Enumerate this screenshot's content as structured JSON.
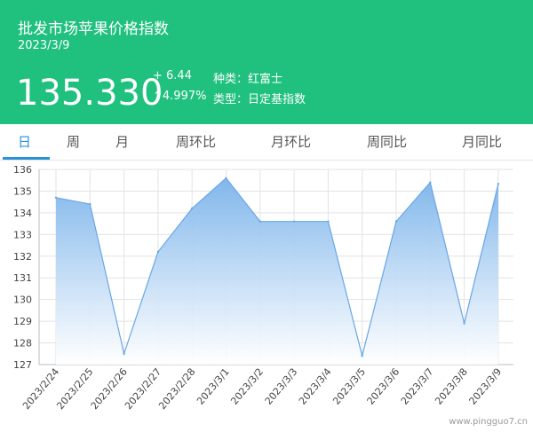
{
  "header": {
    "title": "批发市场苹果价格指数",
    "date": "2023/3/9",
    "price": "135.330",
    "change": "+ 6.44",
    "change_pct": "↑4.997%",
    "variety_label": "种类：红富士",
    "type_label": "类型：日定基指数"
  },
  "tabs": [
    "日",
    "周",
    "月",
    "周环比",
    "月环比",
    "周同比",
    "月同比"
  ],
  "watermark": "www.pingguo7.cn",
  "colors": {
    "header_bg": "#20c07f",
    "active_tab": "#2a93d8",
    "area_top": "#7ab3ea",
    "area_bottom": "#ffffff",
    "line": "#6aa6e6"
  },
  "chart_data": {
    "type": "area",
    "categories": [
      "2023/2/24",
      "2023/2/25",
      "2023/2/26",
      "2023/2/27",
      "2023/2/28",
      "2023/3/1",
      "2023/3/2",
      "2023/3/3",
      "2023/3/4",
      "2023/3/5",
      "2023/3/6",
      "2023/3/7",
      "2023/3/8",
      "2023/3/9"
    ],
    "values": [
      134.7,
      134.4,
      127.5,
      132.2,
      134.2,
      135.6,
      133.6,
      133.6,
      133.6,
      127.4,
      133.6,
      135.4,
      128.9,
      135.33
    ],
    "ylim": [
      127,
      136
    ],
    "yticks": [
      127,
      128,
      129,
      130,
      131,
      132,
      133,
      134,
      135,
      136
    ],
    "grid": true
  }
}
